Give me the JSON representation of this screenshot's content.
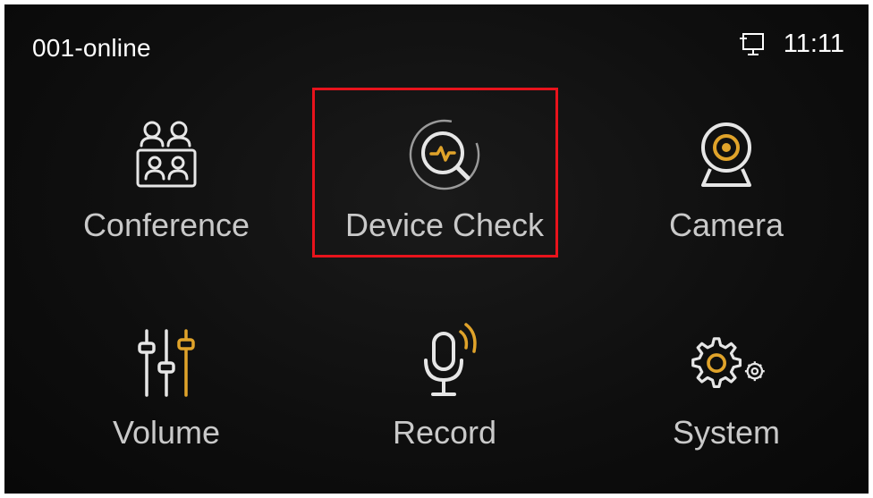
{
  "status": {
    "device_name": "001-online",
    "time": "11:11",
    "network_icon": "network-monitor-icon"
  },
  "menu": [
    {
      "id": "conference",
      "label": "Conference",
      "icon": "conference-icon"
    },
    {
      "id": "device_check",
      "label": "Device Check",
      "icon": "device-check-icon",
      "highlighted": true
    },
    {
      "id": "camera",
      "label": "Camera",
      "icon": "camera-icon"
    },
    {
      "id": "volume",
      "label": "Volume",
      "icon": "volume-sliders-icon"
    },
    {
      "id": "record",
      "label": "Record",
      "icon": "microphone-icon"
    },
    {
      "id": "system",
      "label": "System",
      "icon": "gears-icon"
    }
  ],
  "colors": {
    "background": "#0e0e0e",
    "label": "#c9c9c9",
    "icon_line": "#e6e6e6",
    "accent": "#e0a32a",
    "highlight_border": "#e8131c"
  }
}
